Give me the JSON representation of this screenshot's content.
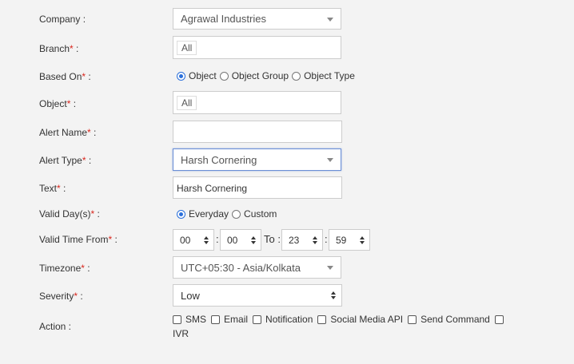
{
  "form": {
    "company": {
      "label": "Company :",
      "value": "Agrawal Industries"
    },
    "branch": {
      "label": "Branch",
      "suffix": " :",
      "tag": "All"
    },
    "based_on": {
      "label": "Based On",
      "suffix": " :",
      "options": [
        "Object",
        "Object Group",
        "Object Type"
      ],
      "selected": "Object"
    },
    "object": {
      "label": "Object",
      "suffix": " :",
      "tag": "All"
    },
    "alert_name": {
      "label": "Alert Name",
      "suffix": " :",
      "value": ""
    },
    "alert_type": {
      "label": "Alert Type",
      "suffix": " :",
      "value": "Harsh Cornering"
    },
    "text": {
      "label": "Text",
      "suffix": " :",
      "value": "Harsh Cornering"
    },
    "valid_days": {
      "label": "Valid Day(s)",
      "suffix": " :",
      "options": [
        "Everyday",
        "Custom"
      ],
      "selected": "Everyday"
    },
    "valid_time": {
      "label": "Valid Time From",
      "suffix": " :",
      "from_hh": "00",
      "from_mm": "00",
      "to_label": "To :",
      "to_hh": "23",
      "to_mm": "59",
      "colon": ":"
    },
    "timezone": {
      "label": "Timezone",
      "suffix": " :",
      "value": "UTC+05:30 - Asia/Kolkata"
    },
    "severity": {
      "label": "Severity",
      "suffix": " :",
      "value": "Low"
    },
    "action": {
      "label": "Action :",
      "options": [
        "SMS",
        "Email",
        "Notification",
        "Social Media API",
        "Send Command",
        "IVR"
      ]
    },
    "required_mark": "*"
  },
  "colors": {
    "required": "#d9251c",
    "radio_selected": "#2a6fdb",
    "focus_border": "#6b8fd6"
  }
}
